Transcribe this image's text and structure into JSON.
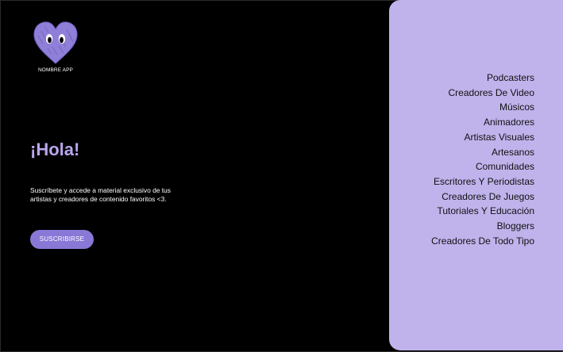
{
  "header": {
    "logo_icon": "heart-face-logo-icon",
    "app_name": "NOMBRE APP"
  },
  "hero": {
    "greeting": "¡Hola!",
    "description": "Suscríbete y accede a material exclusivo de tus artistas y creadores de contenido favoritos <3.",
    "subscribe_label": "SUSCRIBIRSE"
  },
  "categories": [
    "Podcasters",
    "Creadores De Video",
    "Músicos",
    "Animadores",
    "Artistas Visuales",
    "Artesanos",
    "Comunidades",
    "Escritores Y Periodistas",
    "Creadores De Juegos",
    "Tutoriales Y Educación",
    "Bloggers",
    "Creadores De Todo Tipo"
  ],
  "colors": {
    "background": "#000000",
    "panel": "#c0b3ec",
    "accent": "#8978d6",
    "greeting": "#b9a6ee",
    "logo": "#8f7fd8"
  }
}
